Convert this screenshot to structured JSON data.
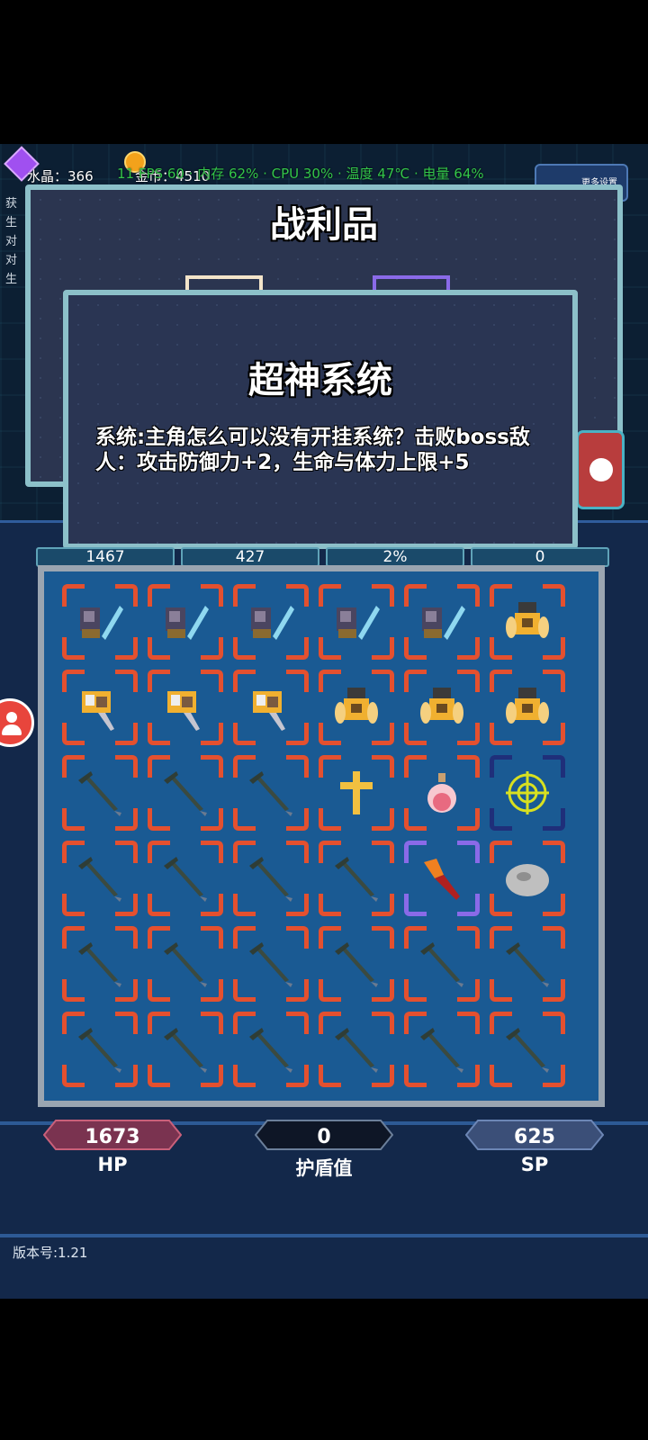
{
  "topbar": {
    "crystal_label": "水晶：366",
    "gold_label": "金币：4510",
    "status_overlay": "11 FPS 60 · 内存 62% · CPU 30% · 温度 47℃ · 电量 64%",
    "settings_label": "更多设置"
  },
  "left_log": [
    "获",
    "生",
    "对",
    "对",
    "生"
  ],
  "loot_panel": {
    "title": "战利品"
  },
  "dialog": {
    "title": "超神系统",
    "body": "系统:主角怎么可以没有开挂系统？击败boss敌人：攻击防御力+2，生命与体力上限+5"
  },
  "stats_row": [
    "1467",
    "427",
    "2%",
    "0"
  ],
  "inventory": {
    "rows": [
      [
        "sword-gauntlet",
        "sword-gauntlet",
        "sword-gauntlet",
        "sword-gauntlet",
        "sword-gauntlet",
        "gold-armor"
      ],
      [
        "gold-gauntlet",
        "gold-gauntlet",
        "gold-gauntlet",
        "gold-armor",
        "gold-armor",
        "gold-armor"
      ],
      [
        "dark-trident",
        "dark-trident",
        "dark-trident",
        "gold-cross",
        "potion",
        "web-rune"
      ],
      [
        "dark-trident",
        "dark-trident",
        "dark-trident",
        "dark-trident",
        "fire-dagger",
        "stone"
      ],
      [
        "dark-trident",
        "dark-trident",
        "dark-trident",
        "dark-trident",
        "dark-trident",
        "dark-trident"
      ],
      [
        "dark-trident",
        "dark-trident",
        "dark-trident",
        "dark-trident",
        "dark-trident",
        "dark-trident"
      ]
    ],
    "frame_colors": {
      "common": "#e4502f",
      "rare": "#8a6ae8",
      "dark": "#1f2f7a"
    }
  },
  "vitals": {
    "hp_value": "1673",
    "hp_label": "HP",
    "shield_value": "0",
    "shield_label": "护盾值",
    "sp_value": "625",
    "sp_label": "SP"
  },
  "version": "版本号:1.21"
}
